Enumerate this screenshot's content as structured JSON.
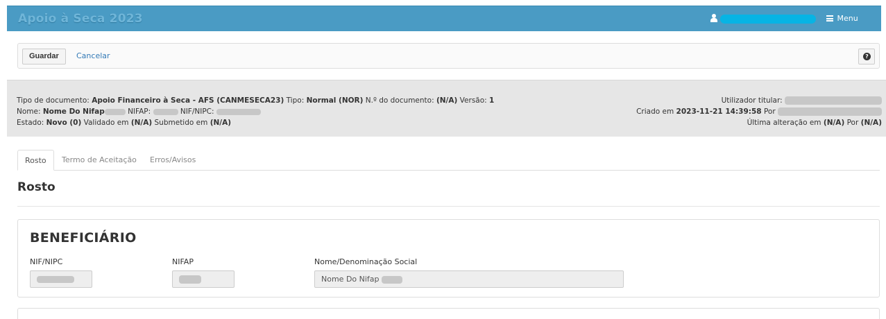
{
  "header": {
    "app_title": "Apoio à Seca 2023",
    "menu_label": "Menu",
    "user_icon": "user-icon",
    "menu_icon": "list-icon",
    "bar_color": "#4a9bc4"
  },
  "toolbar": {
    "save_label": "Guardar",
    "cancel_label": "Cancelar",
    "help_glyph": "?",
    "help_icon": "question-circle-icon"
  },
  "info": {
    "doc_type_label": "Tipo de documento:",
    "doc_type_value": "Apoio Financeiro à Seca - AFS (CANMESECA23)",
    "tipo_label": "Tipo:",
    "tipo_value": "Normal (NOR)",
    "doc_number_label": "N.º do documento:",
    "doc_number_value": "(N/A)",
    "version_label": "Versão:",
    "version_value": "1",
    "name_label": "Nome:",
    "name_value": "Nome Do Nifap",
    "nifap_label": "NIFAP:",
    "nif_label": "NIF/NIPC:",
    "state_label": "Estado:",
    "state_value": "Novo (0)",
    "validated_label": "Validado em",
    "validated_value": "(N/A)",
    "submitted_label": "Submetido em",
    "submitted_value": "(N/A)",
    "holder_label": "Utilizador titular:",
    "created_label": "Criado em",
    "created_value": "2023-11-21 14:39:58",
    "by_label": "Por",
    "last_change_label": "Última alteração em",
    "last_change_value": "(N/A)",
    "last_change_by_value": "(N/A)"
  },
  "tabs": [
    {
      "label": "Rosto",
      "active": true
    },
    {
      "label": "Termo de Aceitação",
      "active": false
    },
    {
      "label": "Erros/Avisos",
      "active": false
    }
  ],
  "main": {
    "section_title": "Rosto",
    "panel_title": "BENEFICIÁRIO",
    "fields": [
      {
        "label": "NIF/NIPC",
        "value": ""
      },
      {
        "label": "NIFAP",
        "value": ""
      },
      {
        "label": "Nome/Denominação Social",
        "value": "Nome Do Nifap"
      }
    ]
  }
}
